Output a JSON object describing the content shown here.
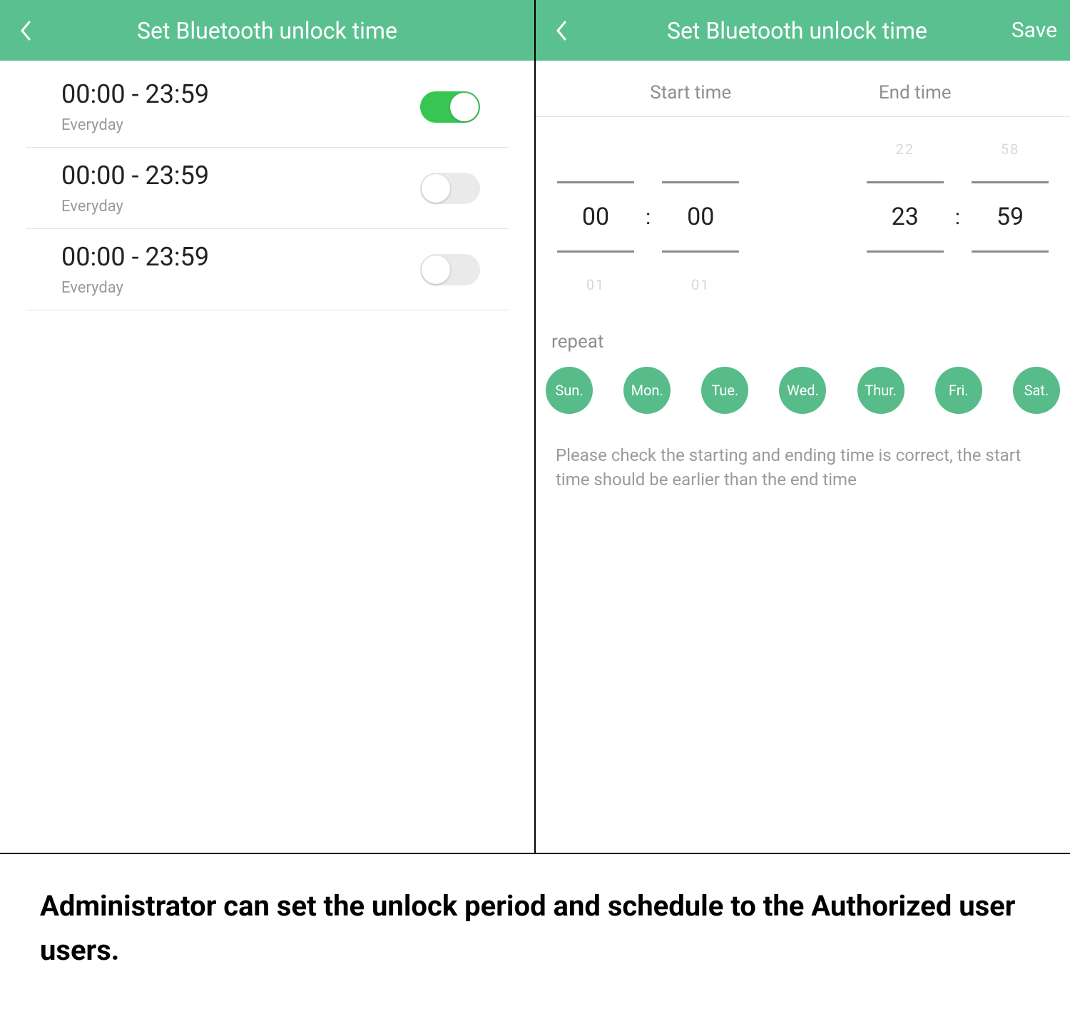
{
  "left": {
    "title": "Set Bluetooth unlock time",
    "rows": [
      {
        "range": "00:00 - 23:59",
        "sub": "Everyday",
        "on": true
      },
      {
        "range": "00:00 - 23:59",
        "sub": "Everyday",
        "on": false
      },
      {
        "range": "00:00 - 23:59",
        "sub": "Everyday",
        "on": false
      }
    ]
  },
  "right": {
    "title": "Set Bluetooth unlock time",
    "save": "Save",
    "tab_start": "Start time",
    "tab_end": "End time",
    "start": {
      "h_prev": "",
      "h": "00",
      "h_next": "01",
      "m_prev": "",
      "m": "00",
      "m_next": "01"
    },
    "end": {
      "h_prev": "22",
      "h": "23",
      "h_next": "",
      "m_prev": "58",
      "m": "59",
      "m_next": ""
    },
    "colon": ":",
    "repeat_label": "repeat",
    "days": [
      "Sun.",
      "Mon.",
      "Tue.",
      "Wed.",
      "Thur.",
      "Fri.",
      "Sat."
    ],
    "hint": "Please check the starting and ending time is correct, the start time should be earlier than the end time"
  },
  "caption": "Administrator can set the unlock period and schedule to the Authorized user users."
}
